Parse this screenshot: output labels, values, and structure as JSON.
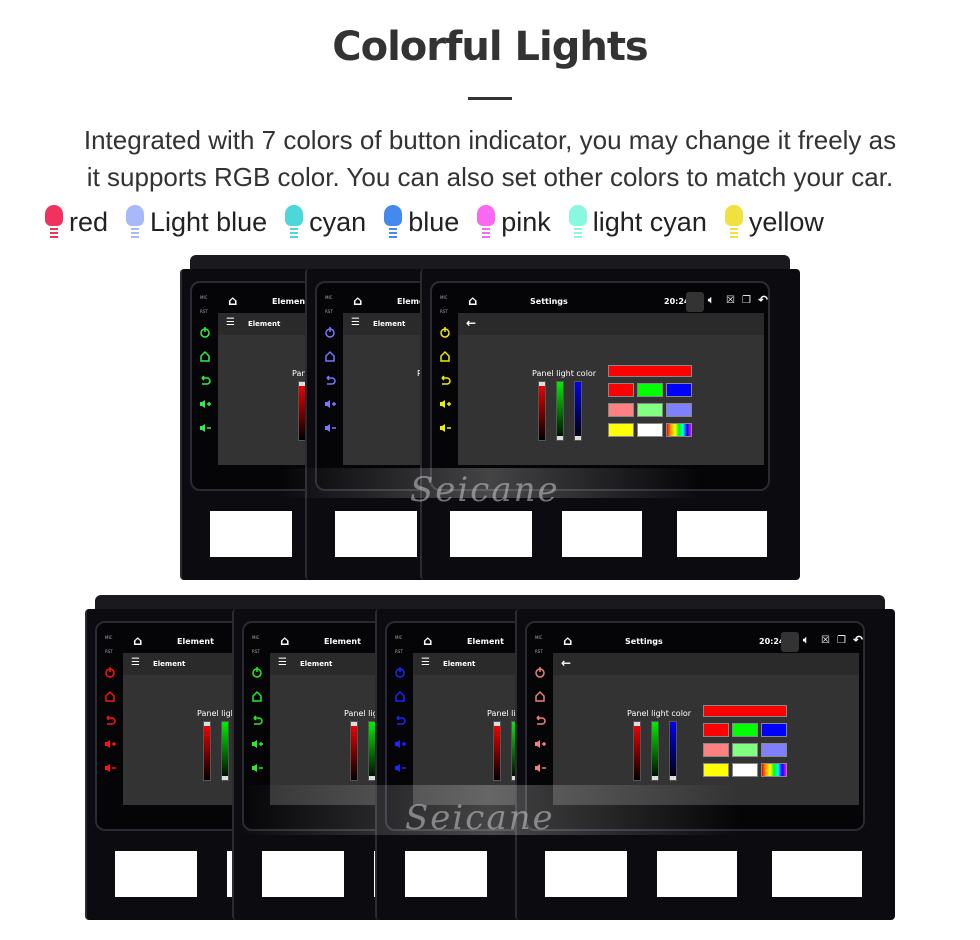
{
  "title": "Colorful Lights",
  "subtitle_lines": [
    "Integrated with 7 colors of button indicator, you may change it freely as",
    "it supports RGB color. You can also set other colors to match your car."
  ],
  "legend": [
    {
      "label": "red",
      "color": "#f0325e"
    },
    {
      "label": "Light blue",
      "color": "#a8b8f8"
    },
    {
      "label": "cyan",
      "color": "#4cd8d8"
    },
    {
      "label": "blue",
      "color": "#4488f0"
    },
    {
      "label": "pink",
      "color": "#f868f0"
    },
    {
      "label": "light cyan",
      "color": "#88f8e0"
    },
    {
      "label": "yellow",
      "color": "#f0e040"
    }
  ],
  "watermark": "Seicane",
  "panel_label": "Panel light color",
  "clock": "20:24",
  "side_labels": [
    "MIC",
    "RST"
  ],
  "swatches": [
    "#ff0000",
    "#ff0000",
    "#00ff00",
    "#0000ff",
    "#ff8080",
    "#80ff80",
    "#8080ff",
    "#ffff00",
    "#ffffff",
    "rainbow"
  ],
  "rows": [
    {
      "units": [
        {
          "screen_title": "Element",
          "sub_title": "Element",
          "icon_color": "#33ee44",
          "full": false
        },
        {
          "screen_title": "Element",
          "sub_title": "Element",
          "icon_color": "#7777ff",
          "full": false
        },
        {
          "screen_title": "Settings",
          "sub_title": "",
          "icon_color": "#eeee00",
          "full": true
        }
      ]
    },
    {
      "units": [
        {
          "screen_title": "Element",
          "sub_title": "Element",
          "icon_color": "#ff1111",
          "full": false
        },
        {
          "screen_title": "Element",
          "sub_title": "Element",
          "icon_color": "#22ee22",
          "full": false
        },
        {
          "screen_title": "Element",
          "sub_title": "Element",
          "icon_color": "#2222ff",
          "full": false
        },
        {
          "screen_title": "Settings",
          "sub_title": "",
          "icon_color": "#f08080",
          "full": true
        }
      ]
    }
  ]
}
